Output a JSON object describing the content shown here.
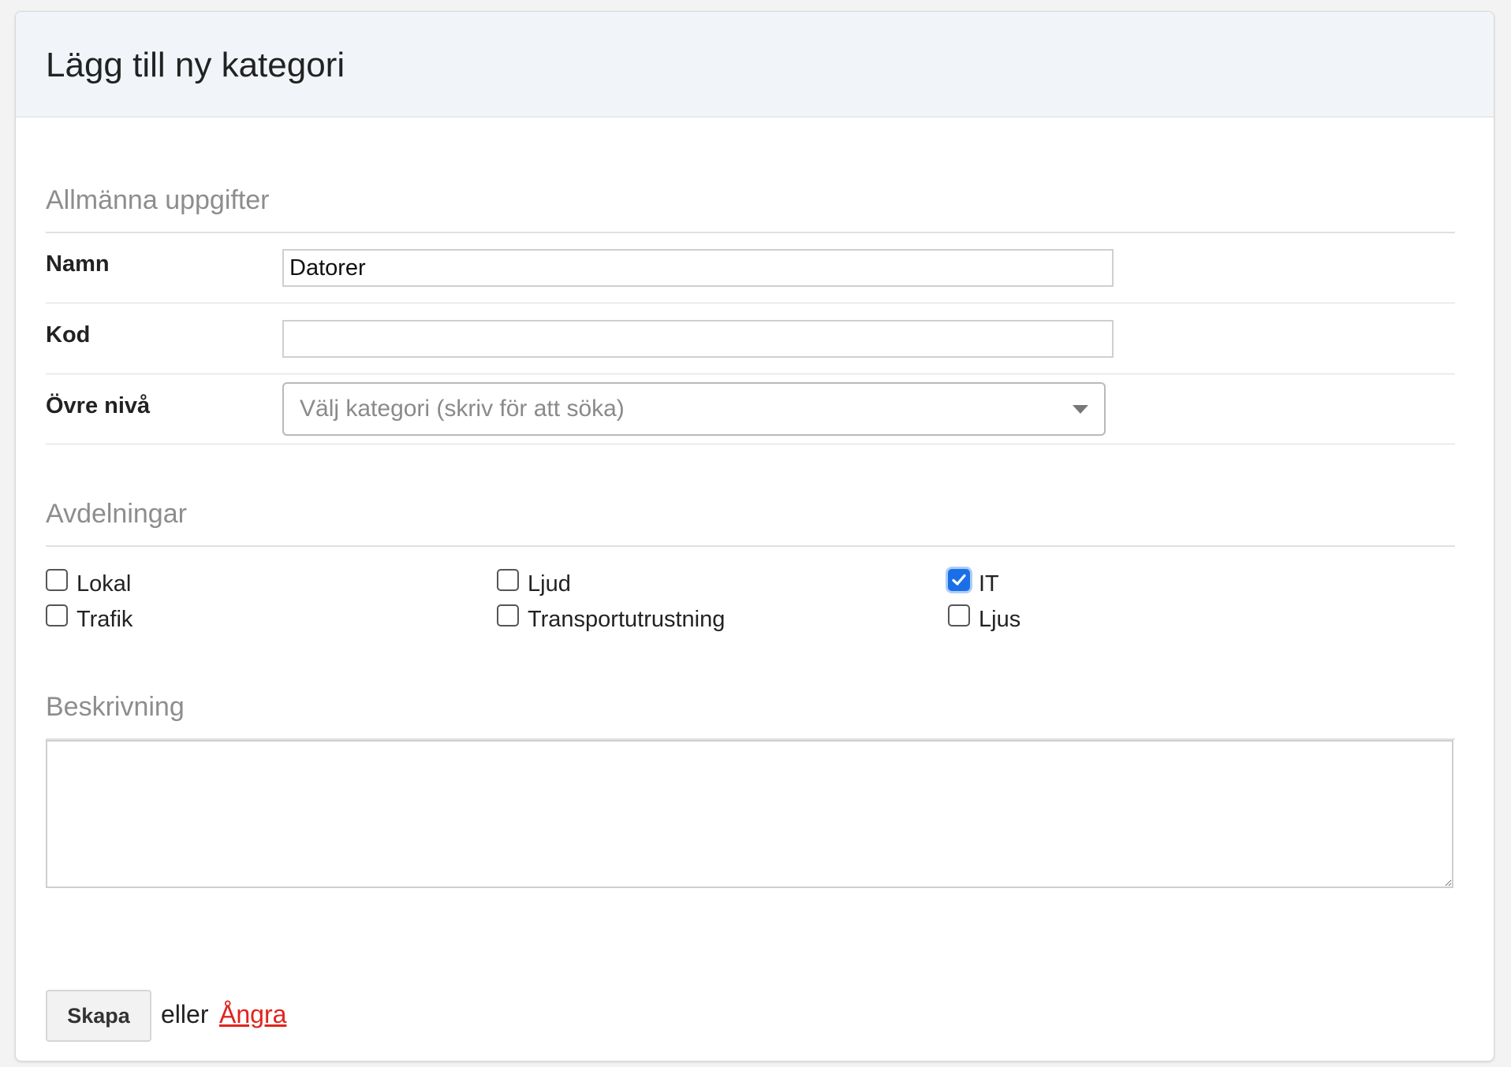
{
  "dialog": {
    "title": "Lägg till ny kategori"
  },
  "general": {
    "heading": "Allmänna uppgifter",
    "name": {
      "label": "Namn",
      "value": "Datorer",
      "placeholder": ""
    },
    "code": {
      "label": "Kod",
      "value": "",
      "placeholder": ""
    },
    "parent": {
      "label": "Övre nivå",
      "placeholder": "Välj kategori (skriv för att söka)"
    }
  },
  "departments": {
    "heading": "Avdelningar",
    "items": [
      {
        "label": "Lokal",
        "checked": false
      },
      {
        "label": "Ljud",
        "checked": false
      },
      {
        "label": "IT",
        "checked": true
      },
      {
        "label": "Trafik",
        "checked": false
      },
      {
        "label": "Transportutrustning",
        "checked": false
      },
      {
        "label": "Ljus",
        "checked": false
      }
    ]
  },
  "description": {
    "heading": "Beskrivning",
    "value": ""
  },
  "actions": {
    "submit_label": "Skapa",
    "or_text": "eller",
    "cancel_label": "Ångra"
  },
  "colors": {
    "accent": "#1a6fe8",
    "link": "#e0241c",
    "header_bg": "#f1f5f9"
  }
}
